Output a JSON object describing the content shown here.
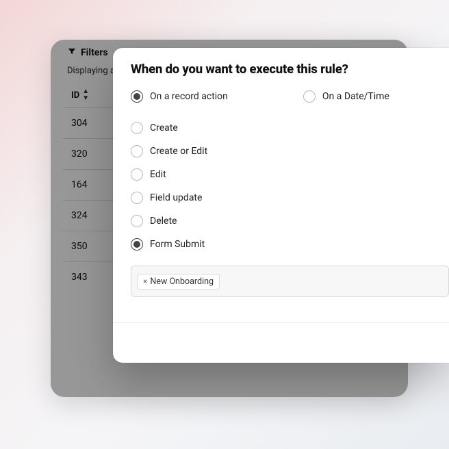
{
  "toolbar": {
    "filters_label": "Filters"
  },
  "subtext": "Displaying a",
  "table": {
    "header_id": "ID",
    "rows": [
      {
        "id": "304"
      },
      {
        "id": "320"
      },
      {
        "id": "164"
      },
      {
        "id": "324"
      },
      {
        "id": "350"
      },
      {
        "id": "343"
      }
    ]
  },
  "modal": {
    "title": "When do you want to execute this rule?",
    "trigger_options": {
      "record_action": {
        "label": "On a record action",
        "selected": true
      },
      "datetime": {
        "label": "On a Date/Time",
        "selected": false
      }
    },
    "action_options": [
      {
        "label": "Create",
        "selected": false
      },
      {
        "label": "Create or Edit",
        "selected": false
      },
      {
        "label": "Edit",
        "selected": false
      },
      {
        "label": "Field update",
        "selected": false
      },
      {
        "label": "Delete",
        "selected": false
      },
      {
        "label": "Form Submit",
        "selected": true
      }
    ],
    "selected_tag": "New Onboarding"
  }
}
